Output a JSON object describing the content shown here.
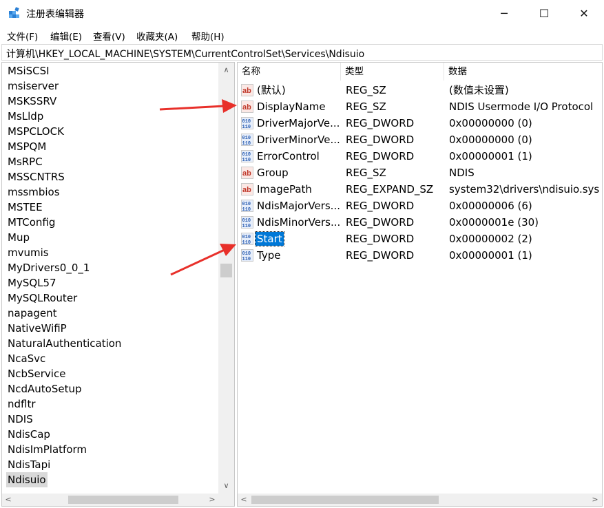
{
  "window": {
    "title": "注册表编辑器",
    "minimize_glyph": "─",
    "maximize_glyph": "☐",
    "close_glyph": "✕"
  },
  "menu": [
    {
      "label": "文件(F)"
    },
    {
      "label": "编辑(E)"
    },
    {
      "label": "查看(V)"
    },
    {
      "label": "收藏夹(A)"
    },
    {
      "label": "帮助(H)"
    }
  ],
  "address": {
    "path": "计算机\\HKEY_LOCAL_MACHINE\\SYSTEM\\CurrentControlSet\\Services\\Ndisuio"
  },
  "tree": {
    "items": [
      {
        "label": "MSiSCSI"
      },
      {
        "label": "msiserver"
      },
      {
        "label": "MSKSSRV"
      },
      {
        "label": "MsLldp"
      },
      {
        "label": "MSPCLOCK"
      },
      {
        "label": "MSPQM"
      },
      {
        "label": "MsRPC"
      },
      {
        "label": "MSSCNTRS"
      },
      {
        "label": "mssmbios"
      },
      {
        "label": "MSTEE"
      },
      {
        "label": "MTConfig"
      },
      {
        "label": "Mup"
      },
      {
        "label": "mvumis"
      },
      {
        "label": "MyDrivers0_0_1"
      },
      {
        "label": "MySQL57"
      },
      {
        "label": "MySQLRouter"
      },
      {
        "label": "napagent"
      },
      {
        "label": "NativeWifiP"
      },
      {
        "label": "NaturalAuthentication"
      },
      {
        "label": "NcaSvc"
      },
      {
        "label": "NcbService"
      },
      {
        "label": "NcdAutoSetup"
      },
      {
        "label": "ndfltr"
      },
      {
        "label": "NDIS"
      },
      {
        "label": "NdisCap"
      },
      {
        "label": "NdisImPlatform"
      },
      {
        "label": "NdisTapi"
      },
      {
        "label": "Ndisuio"
      }
    ],
    "selected": "Ndisuio"
  },
  "list": {
    "columns": {
      "name": "名称",
      "type": "类型",
      "data": "数据"
    },
    "rows": [
      {
        "icon": "string-value-icon",
        "name": "(默认)",
        "type": "REG_SZ",
        "data": "(数值未设置)"
      },
      {
        "icon": "string-value-icon",
        "name": "DisplayName",
        "type": "REG_SZ",
        "data": "NDIS Usermode I/O Protocol"
      },
      {
        "icon": "binary-value-icon",
        "name": "DriverMajorVe...",
        "type": "REG_DWORD",
        "data": "0x00000000 (0)"
      },
      {
        "icon": "binary-value-icon",
        "name": "DriverMinorVe...",
        "type": "REG_DWORD",
        "data": "0x00000000 (0)"
      },
      {
        "icon": "binary-value-icon",
        "name": "ErrorControl",
        "type": "REG_DWORD",
        "data": "0x00000001 (1)"
      },
      {
        "icon": "string-value-icon",
        "name": "Group",
        "type": "REG_SZ",
        "data": "NDIS"
      },
      {
        "icon": "string-value-icon",
        "name": "ImagePath",
        "type": "REG_EXPAND_SZ",
        "data": "system32\\drivers\\ndisuio.sys"
      },
      {
        "icon": "binary-value-icon",
        "name": "NdisMajorVers...",
        "type": "REG_DWORD",
        "data": "0x00000006 (6)"
      },
      {
        "icon": "binary-value-icon",
        "name": "NdisMinorVers...",
        "type": "REG_DWORD",
        "data": "0x0000001e (30)"
      },
      {
        "icon": "binary-value-icon",
        "name": "Start",
        "type": "REG_DWORD",
        "data": "0x00000002 (2)"
      },
      {
        "icon": "binary-value-icon",
        "name": "Type",
        "type": "REG_DWORD",
        "data": "0x00000001 (1)"
      }
    ],
    "selected": "Start"
  },
  "scroll": {
    "up": "∧",
    "down": "∨",
    "left": "<",
    "right": ">"
  },
  "colors": {
    "selection": "#0078d7",
    "tree_selection": "#d9d9d9",
    "annotation_arrow": "#e8302a",
    "string_icon": "#c0392b",
    "binary_icon": "#2a5db0"
  }
}
